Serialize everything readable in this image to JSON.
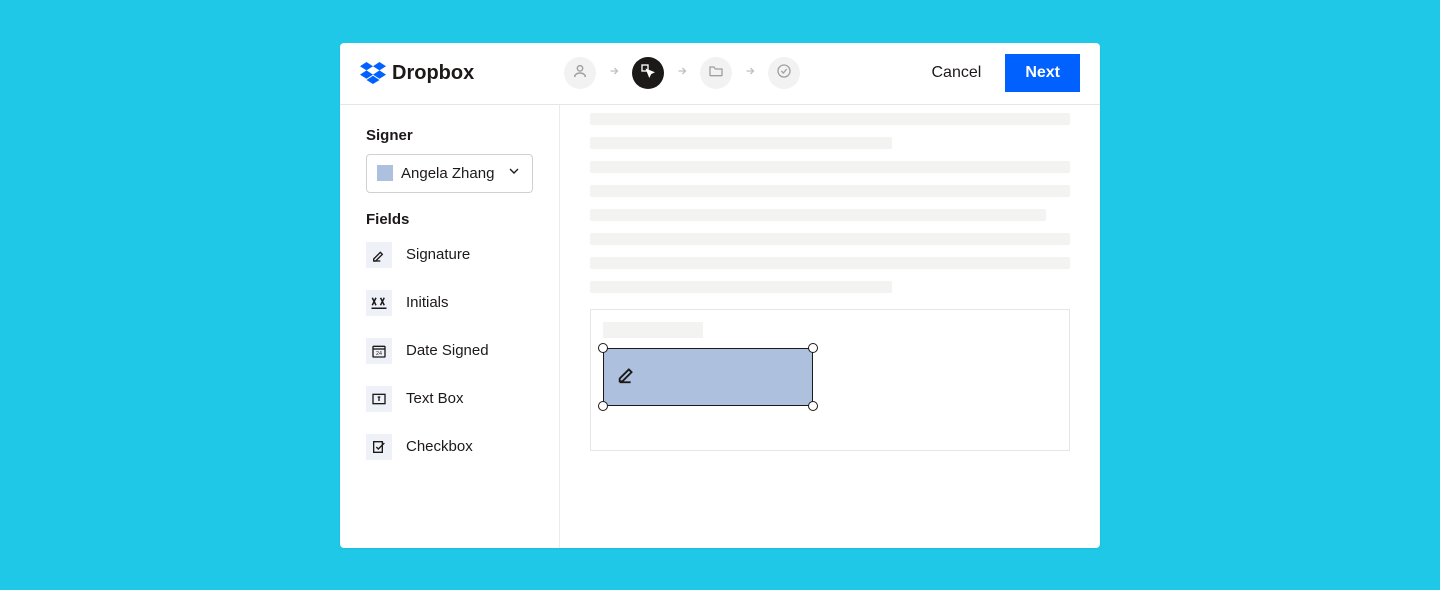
{
  "brand": {
    "name": "Dropbox"
  },
  "header": {
    "cancel_label": "Cancel",
    "next_label": "Next"
  },
  "sidebar": {
    "signer_label": "Signer",
    "signer_selected": "Angela Zhang",
    "fields_label": "Fields",
    "fields": [
      {
        "label": "Signature"
      },
      {
        "label": "Initials"
      },
      {
        "label": "Date Signed"
      },
      {
        "label": "Text Box"
      },
      {
        "label": "Checkbox"
      }
    ]
  }
}
